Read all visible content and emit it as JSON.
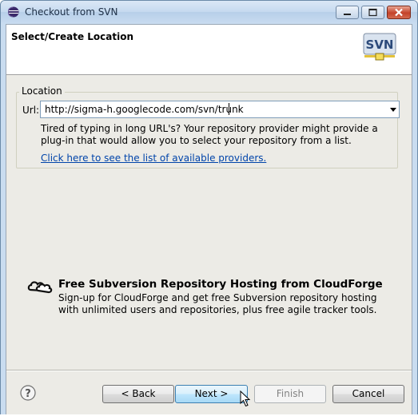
{
  "window": {
    "title": "Checkout from SVN"
  },
  "banner": {
    "title": "Select/Create Location",
    "logo_text": "SVN"
  },
  "location": {
    "group_label": "Location",
    "url_label": "Url:",
    "url_value": "http://sigma-h.googlecode.com/svn/trunk",
    "hint": "Tired of typing in long URL's?  Your repository provider might provide a plug-in that would allow you to select your repository from a list.",
    "providers_link": "Click here to see the list of available providers."
  },
  "cloudforge": {
    "title": "Free Subversion Repository Hosting from CloudForge",
    "description": "Sign-up for CloudForge and get free Subversion repository hosting with unlimited users and repositories, plus free agile tracker tools."
  },
  "buttons": {
    "back": "< Back",
    "next": "Next >",
    "finish": "Finish",
    "cancel": "Cancel"
  },
  "icons": {
    "app": "eclipse-icon",
    "help": "help-icon",
    "cloudforge": "cloudforge-icon"
  }
}
